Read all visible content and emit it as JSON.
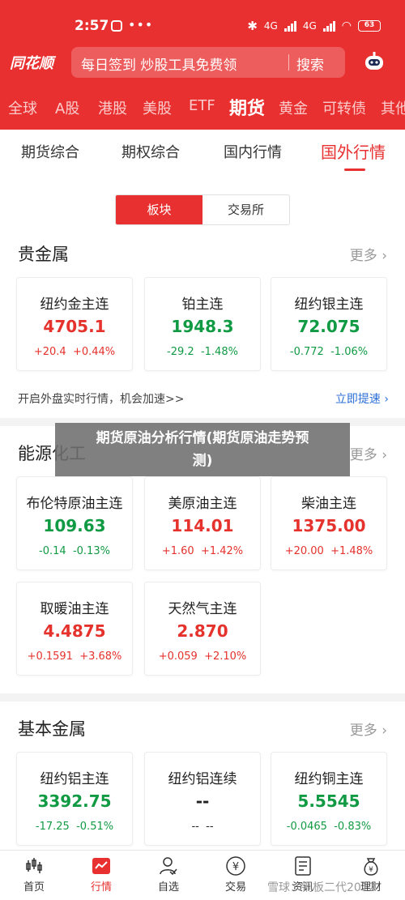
{
  "status": {
    "time": "2:57",
    "dots": "•••",
    "net1": "4G",
    "net2": "4G",
    "battery": "63"
  },
  "header": {
    "logo": "同花顺",
    "search_text": "每日签到 炒股工具免费领",
    "search_button": "搜索",
    "accent": "#e93030"
  },
  "market_tabs": [
    "全球",
    "A股",
    "港股",
    "美股",
    "ETF",
    "期货",
    "黄金",
    "可转债",
    "其他"
  ],
  "sub_tabs": [
    "期货综合",
    "期权综合",
    "国内行情",
    "国外行情"
  ],
  "toggle": [
    "板块",
    "交易所"
  ],
  "sections": {
    "precious": {
      "title": "贵金属",
      "more": "更多",
      "cards": [
        {
          "name": "纽约金主连",
          "price": "4705.1",
          "change": "+20.4",
          "pct": "+0.44%",
          "dir": "up"
        },
        {
          "name": "铂主连",
          "price": "1948.3",
          "change": "-29.2",
          "pct": "-1.48%",
          "dir": "down"
        },
        {
          "name": "纽约银主连",
          "price": "72.075",
          "change": "-0.772",
          "pct": "-1.06%",
          "dir": "down"
        }
      ],
      "promo": "开启外盘实时行情，机会加速>>",
      "promo_link": "立即提速"
    },
    "energy": {
      "title": "能源化工",
      "more": "更多",
      "cards": [
        {
          "name": "布伦特原油主连",
          "price": "109.63",
          "change": "-0.14",
          "pct": "-0.13%",
          "dir": "down"
        },
        {
          "name": "美原油主连",
          "price": "114.01",
          "change": "+1.60",
          "pct": "+1.42%",
          "dir": "up"
        },
        {
          "name": "柴油主连",
          "price": "1375.00",
          "change": "+20.00",
          "pct": "+1.48%",
          "dir": "up"
        },
        {
          "name": "取暖油主连",
          "price": "4.4875",
          "change": "+0.1591",
          "pct": "+3.68%",
          "dir": "up"
        },
        {
          "name": "天然气主连",
          "price": "2.870",
          "change": "+0.059",
          "pct": "+2.10%",
          "dir": "up"
        }
      ]
    },
    "base": {
      "title": "基本金属",
      "more": "更多",
      "cards": [
        {
          "name": "纽约铝主连",
          "price": "3392.75",
          "change": "-17.25",
          "pct": "-0.51%",
          "dir": "down"
        },
        {
          "name": "纽约铝连续",
          "price": "--",
          "change": "--",
          "pct": "--",
          "dir": "flat"
        },
        {
          "name": "纽约铜主连",
          "price": "5.5545",
          "change": "-0.0465",
          "pct": "-0.83%",
          "dir": "down"
        }
      ]
    }
  },
  "overlay": {
    "line1": "期货原油分析行情(期货原油走势预",
    "line2": "测)"
  },
  "bottom_nav": [
    "首页",
    "行情",
    "自选",
    "交易",
    "资讯",
    "理财"
  ],
  "watermark": "雪球：铜板二代2012"
}
